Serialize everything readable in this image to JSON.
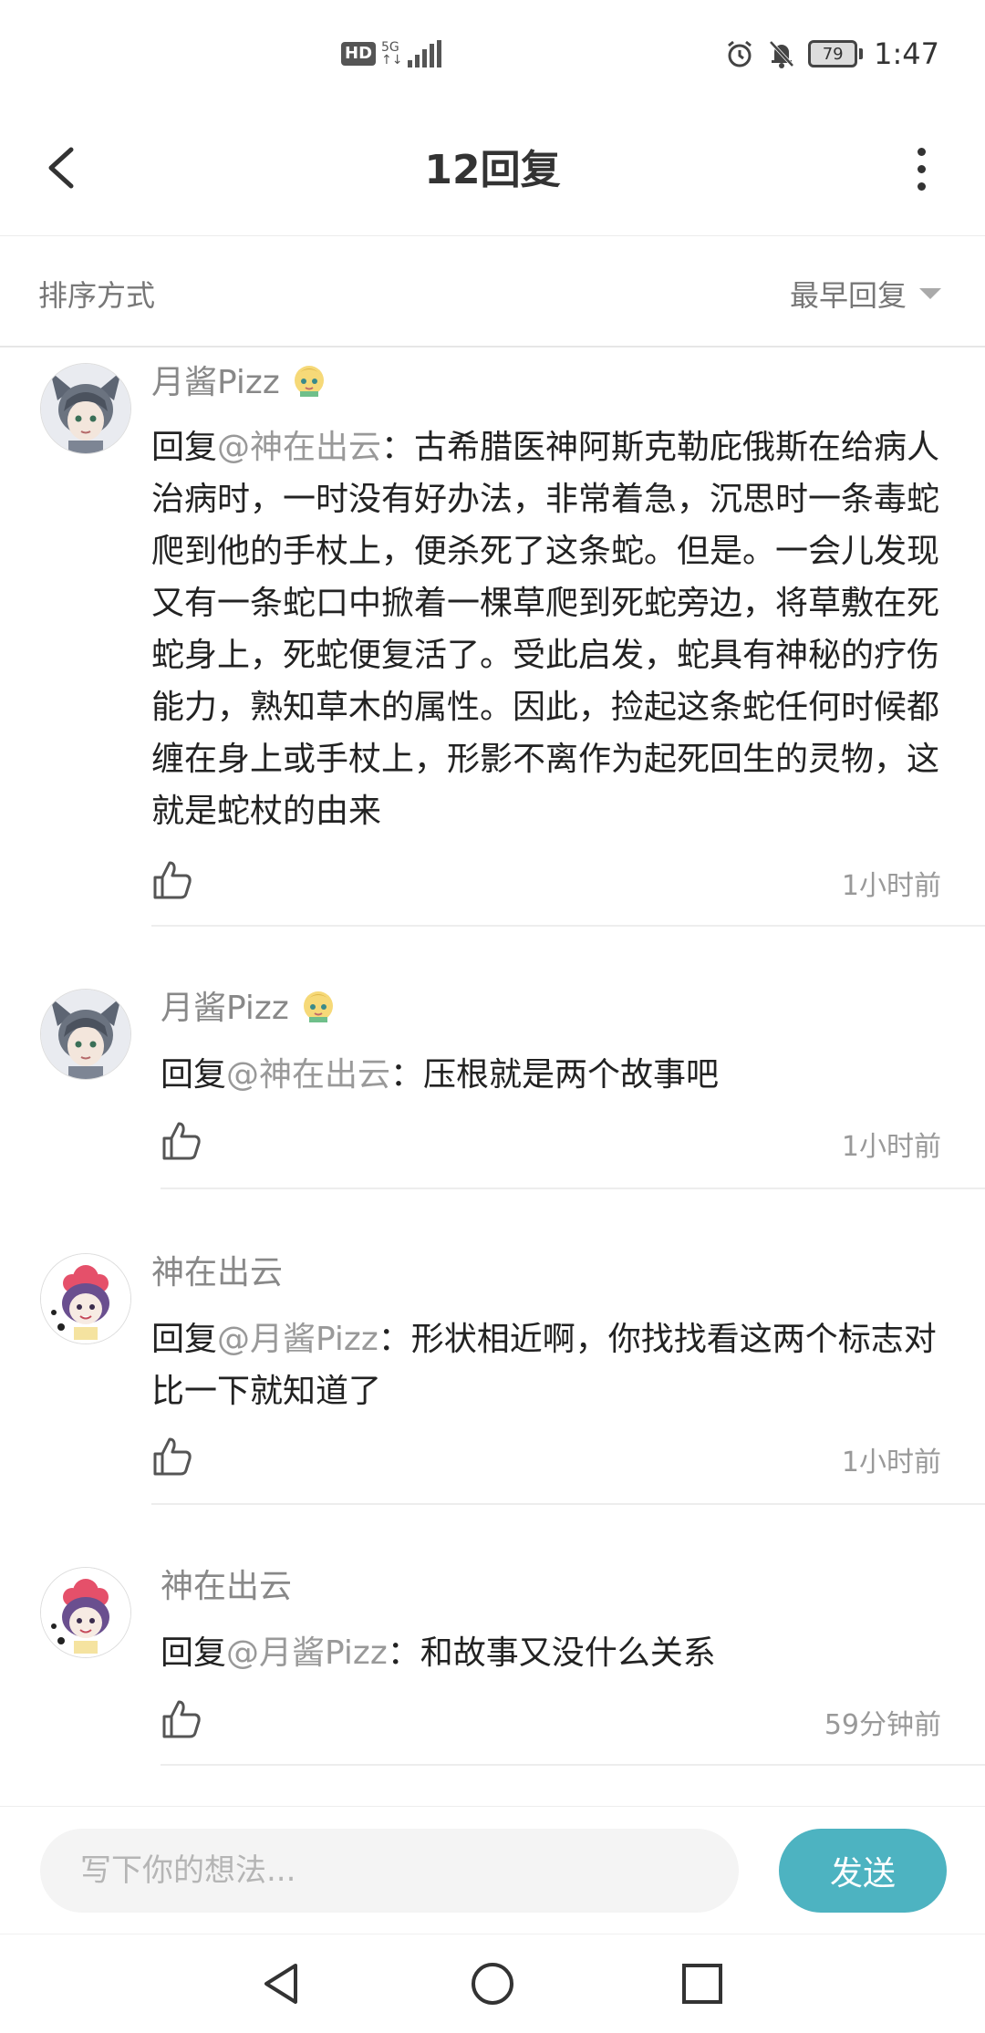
{
  "status_bar": {
    "hd": "HD",
    "network": "5G",
    "battery": "79",
    "time": "1:47"
  },
  "header": {
    "title": "12回复"
  },
  "sort": {
    "label": "排序方式",
    "selected": "最早回复"
  },
  "comments": [
    {
      "username": "月酱Pizz",
      "reply_prefix": "回复",
      "mention": "@神在出云",
      "body": "：古希腊医神阿斯克勒庇俄斯在给病人治病时，一时没有好办法，非常着急，沉思时一条毒蛇爬到他的手杖上，便杀死了这条蛇。但是。一会儿发现又有一条蛇口中掀着一棵草爬到死蛇旁边，将草敷在死蛇身上，死蛇便复活了。受此启发，蛇具有神秘的疗伤能力，熟知草木的属性。因此，捡起这条蛇任何时候都缠在身上或手杖上，形影不离作为起死回生的灵物，这就是蛇杖的由来",
      "time": "1小时前"
    },
    {
      "username": "月酱Pizz",
      "reply_prefix": "回复",
      "mention": "@神在出云",
      "body": "：压根就是两个故事吧",
      "time": "1小时前"
    },
    {
      "username": "神在出云",
      "reply_prefix": "回复",
      "mention": "@月酱Pizz",
      "body": "：形状相近啊，你找找看这两个标志对比一下就知道了",
      "time": "1小时前"
    },
    {
      "username": "神在出云",
      "reply_prefix": "回复",
      "mention": "@月酱Pizz",
      "body": "：和故事又没什么关系",
      "time": "59分钟前"
    }
  ],
  "input": {
    "placeholder": "写下你的想法...",
    "send_label": "发送"
  },
  "colors": {
    "accent": "#4db3c1",
    "mention": "#999999"
  }
}
